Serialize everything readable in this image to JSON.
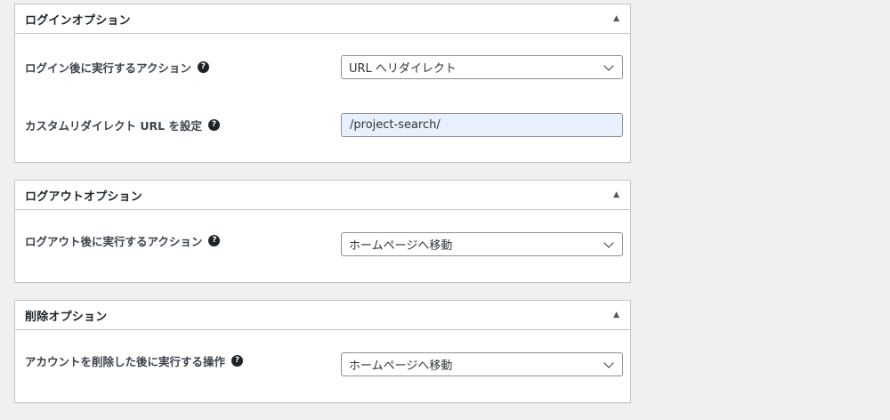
{
  "sections": [
    {
      "title": "ログインオプション",
      "rows": [
        {
          "label": "ログイン後に実行するアクション",
          "type": "select",
          "value": "URL へリダイレクト"
        },
        {
          "label": "カスタムリダイレクト URL を設定",
          "type": "text",
          "value": "/project-search/"
        }
      ]
    },
    {
      "title": "ログアウトオプション",
      "rows": [
        {
          "label": "ログアウト後に実行するアクション",
          "type": "select",
          "value": "ホームページへ移動"
        }
      ]
    },
    {
      "title": "削除オプション",
      "rows": [
        {
          "label": "アカウントを削除した後に実行する操作",
          "type": "select",
          "value": "ホームページへ移動"
        }
      ]
    }
  ],
  "icons": {
    "toggle": "triangle-up-icon",
    "help": "question-circle-icon",
    "dropdown": "chevron-down-icon"
  },
  "help_glyph": "?",
  "toggle_glyph": "▲"
}
